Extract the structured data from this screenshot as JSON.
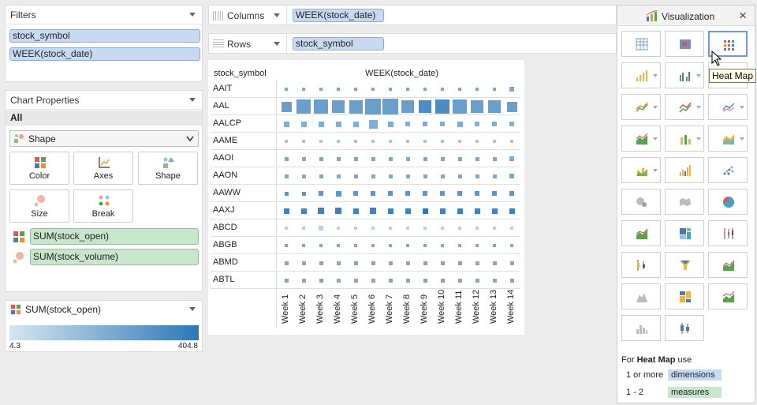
{
  "filters": {
    "title": "Filters",
    "items": [
      "stock_symbol",
      "WEEK(stock_date)"
    ]
  },
  "chart_properties": {
    "title": "Chart Properties",
    "scope": "All",
    "mark_type": "Shape",
    "buttons": {
      "color": "Color",
      "axes": "Axes",
      "shape": "Shape",
      "size": "Size",
      "break": "Break"
    },
    "encodings": {
      "color_field": "SUM(stock_open)",
      "size_field": "SUM(stock_volume)"
    }
  },
  "legend": {
    "title": "SUM(stock_open)",
    "min": "4.3",
    "max": "404.8",
    "color_low": "#d6e6ef",
    "color_high": "#2b78b7"
  },
  "shelves": {
    "columns_label": "Columns",
    "columns_value": "WEEK(stock_date)",
    "rows_label": "Rows",
    "rows_value": "stock_symbol"
  },
  "chart": {
    "row_header": "stock_symbol",
    "col_header": "WEEK(stock_date)",
    "rows": [
      "AAIT",
      "AAL",
      "AALCP",
      "AAME",
      "AAOI",
      "AAON",
      "AAWW",
      "AAXJ",
      "ABCD",
      "ABGB",
      "ABMD",
      "ABTL"
    ],
    "weeks": [
      "Week 1",
      "Week 2",
      "Week 3",
      "Week 4",
      "Week 5",
      "Week 6",
      "Week 7",
      "Week 8",
      "Week 9",
      "Week 10",
      "Week 11",
      "Week 12",
      "Week 13",
      "Week 14"
    ]
  },
  "visualization": {
    "title": "Visualization",
    "close": "×",
    "tooltip": "Heat Map",
    "hint_prefix": "For",
    "hint_name": "Heat Map",
    "hint_suffix": "use",
    "req_dims_count": "1 or more",
    "req_dims_label": "dimensions",
    "req_meas_count": "1 - 2",
    "req_meas_label": "measures"
  }
}
